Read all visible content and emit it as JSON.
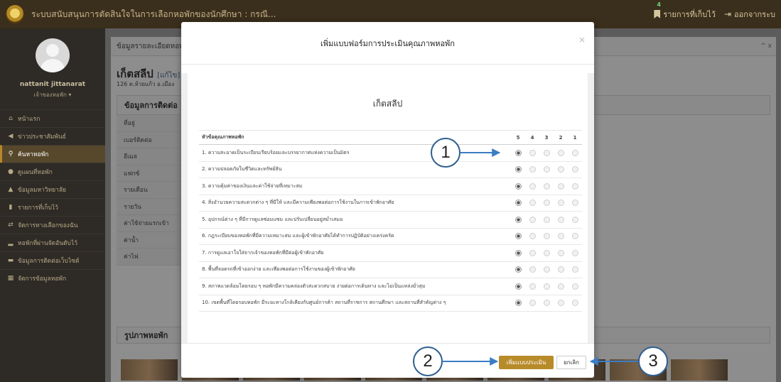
{
  "app": {
    "title": "ระบบสนับสนุนการตัดสินใจในการเลือกหอพักของนักศึกษา : กรณี...",
    "bookmarks_badge": "4",
    "bookmarks_label": "รายการที่เก็บไว้",
    "logout_label": "ออกจากระบ"
  },
  "user": {
    "name": "nattanit jittanarat",
    "role": "เจ้าของหอพัก ▾"
  },
  "sidebar": {
    "items": [
      {
        "icon": "home-icon",
        "glyph": "⌂",
        "label": "หน้าแรก"
      },
      {
        "icon": "megaphone-icon",
        "glyph": "◀",
        "label": "ข่าวประชาสัมพันธ์"
      },
      {
        "icon": "search-icon",
        "glyph": "⚲",
        "label": "ค้นหาหอพัก",
        "active": true
      },
      {
        "icon": "map-pin-icon",
        "glyph": "●",
        "label": "ดูแผนที่หอพัก"
      },
      {
        "icon": "graduation-cap-icon",
        "glyph": "▲",
        "label": "ข้อมูลมหาวิทยาลัย"
      },
      {
        "icon": "bookmark-icon",
        "glyph": "▮",
        "label": "รายการที่เก็บไว้"
      },
      {
        "icon": "exchange-icon",
        "glyph": "⇄",
        "label": "จัดการทางเลือกของฉัน"
      },
      {
        "icon": "bar-chart-icon",
        "glyph": "▂",
        "label": "หอพักที่ผ่านจัดอันดับไว้"
      },
      {
        "icon": "comment-icon",
        "glyph": "▬",
        "label": "ข้อมูลการติดต่อเว็บไซต์"
      },
      {
        "icon": "table-icon",
        "glyph": "▦",
        "label": "จัดการข้อมูลหอพัก"
      }
    ]
  },
  "background": {
    "panel_title": "ข้อมูลรายละเอียดหอพัก",
    "panel_tools": "^ x",
    "place_name": "เก็ตสลีป",
    "place_edit": "[แก้ไข]",
    "place_address": "126 ต.ห้วยแก้ว อ.เมือง",
    "contact_header": "ข้อมูลการติดต่อ",
    "contact_rows": [
      "ที่อยู่",
      "เบอร์ติดต่อ",
      "อีเมล",
      "แฟกซ์",
      "รายเดือน",
      "รายวัน",
      "ค่าใช้จ่ายแรกเข้า",
      "ค่าน้ำ",
      "ค่าไฟ"
    ],
    "photo_header": "รูปภาพหอพัก"
  },
  "modal": {
    "title": "เพิ่มแบบฟอร์มการประเมินคุณภาพหอพัก",
    "close_glyph": "×",
    "subtitle": "เก็ตสลีป",
    "table_header": "หัวข้อคุณภาพหอพัก",
    "scores": [
      "5",
      "4",
      "3",
      "2",
      "1"
    ],
    "questions": [
      {
        "text": "1. ความสะอาดเป็นระเบียบเรียบร้อยและบรรยากาศแห่งความเป็นมิตร",
        "selected": "5"
      },
      {
        "text": "2. ความปลอดภัยในชีวิตและทรัพย์สิน",
        "selected": "5"
      },
      {
        "text": "3. ความคุ้มค่าของเงินและค่าใช้จ่ายที่เหมาะสม",
        "selected": "5"
      },
      {
        "text": "4. สิ่งอำนวยความสะดวกต่าง ๆ ที่มีให้ และมีความเพียงพอต่อการใช้งานในการเข้าพักอาศัย",
        "selected": "5"
      },
      {
        "text": "5. อุปกรณ์ต่าง ๆ ที่มีการดูแลซ่อมแซม และปรับเปลี่ยนอยู่สม่ำเสมอ",
        "selected": "5"
      },
      {
        "text": "6. กฎระเบียบของหอพักที่มีความเหมาะสม และผู้เข้าพักอาศัยได้ทำการปฏิบัติอย่างเคร่งครัด",
        "selected": "5"
      },
      {
        "text": "7. การดูแลเอาใจใส่จากเจ้าของหอพักที่มีต่อผู้เข้าพักอาศัย",
        "selected": "5"
      },
      {
        "text": "8. พื้นที่จอดรถที่เข้าออกง่าย และเพียงพอต่อการใช้งานของผู้เข้าพักอาศัย",
        "selected": "5"
      },
      {
        "text": "9. สภาพแวดล้อมโดยรอบ ๆ หอพักมีความคล่องตัวสะดวกสบาย ง่ายต่อการเดินทาง และไม่เป็นแหล่งมั่วสุม",
        "selected": "5"
      },
      {
        "text": "10. เขตพื้นที่โดยรอบหอพัก มีระยะทางใกล้เคียงกับศูนย์การค้า สถานที่ราชการ สถานศึกษา และสถานที่สำคัญต่าง ๆ",
        "selected": "5"
      }
    ],
    "add_button": "เพิ่มแบบประเมิน",
    "cancel_button": "ยกเลิก"
  },
  "callouts": [
    "1",
    "2",
    "3"
  ],
  "colors": {
    "topbar": "#3a2e1c",
    "accent": "#b88b2a",
    "callout_border": "#2f5f8f"
  }
}
